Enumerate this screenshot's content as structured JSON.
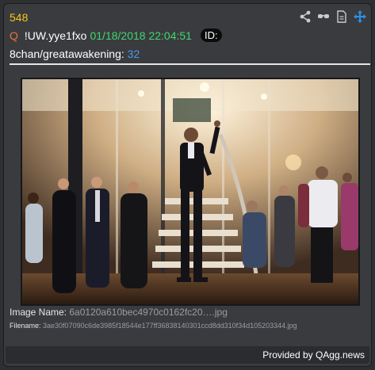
{
  "post": {
    "number": "548",
    "q_letter": "Q",
    "tripcode": "!UW.yye1fxo",
    "timestamp": "01/18/2018 22:04:51",
    "id_label": "ID:",
    "board": "8chan/greatawakening:",
    "reply_number": "32"
  },
  "toolbar": {
    "icons": [
      "share-icon",
      "glasses-icon",
      "document-icon",
      "move-icon"
    ]
  },
  "attachment": {
    "image_name_label": "Image Name:",
    "image_name": "6a0120a610bec4970c0162fc20….jpg",
    "filename_label": "Filename:",
    "filename": "3ae30f07090c6de3985f18544e177ff36838140301ccd8dd310f34d105203344.jpg"
  },
  "footer": {
    "credit": "Provided by QAgg.news"
  },
  "colors": {
    "post_number": "#f5c518",
    "q_letter": "#e8743b",
    "timestamp": "#3fd76e",
    "board_link": "#4a9be8",
    "card_bg": "#3a3b3f",
    "move_icon": "#2f8fe8"
  }
}
